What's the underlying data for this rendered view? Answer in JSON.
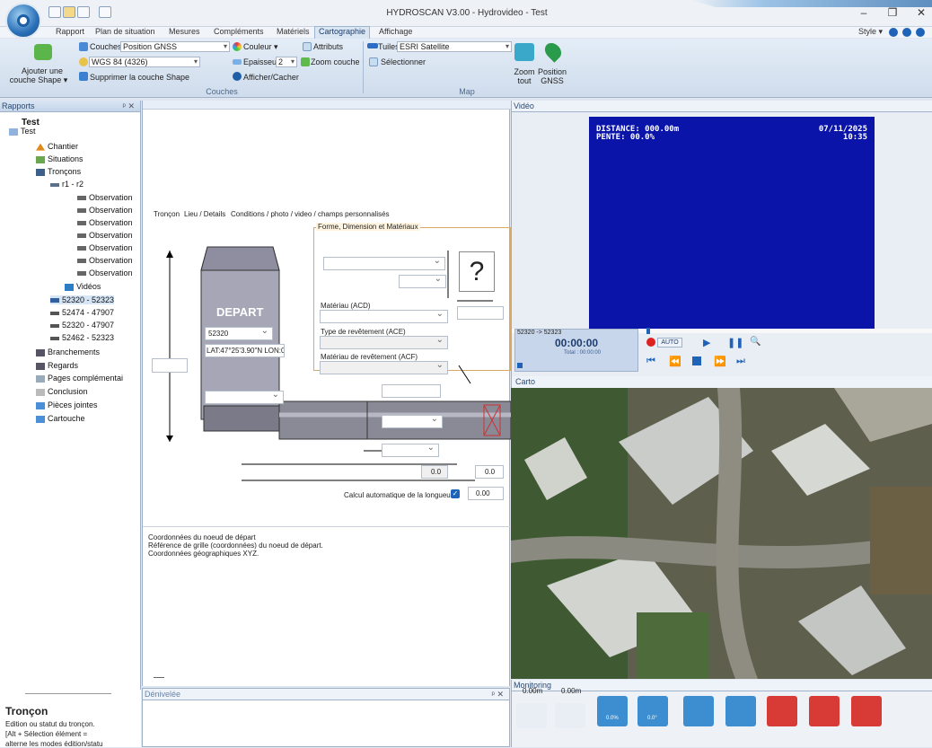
{
  "window": {
    "title": "HYDROSCAN V3.00 - Hydrovideo - Test",
    "minimize": "–",
    "restore": "❐",
    "close": "✕"
  },
  "ribbon_tabs": [
    "Rapport",
    "Plan de situation",
    "Mesures",
    "Compléments",
    "Matériels",
    "Cartographie",
    "Affichage"
  ],
  "active_tab": "Cartographie",
  "style_label": "Style",
  "ribbon": {
    "add_shape": "Ajouter une",
    "add_shape2": "couche Shape",
    "layers_label": "Couches",
    "layers_value": "Position GNSS",
    "crs_value": "WGS 84 (4326)",
    "delete_shape": "Supprimer la couche Shape",
    "color": "Couleur",
    "thickness": "Epaisseur",
    "thickness_value": "2",
    "show_hide": "Afficher/Cacher",
    "attributes": "Attributs",
    "zoom_layer": "Zoom couche",
    "tiles_label": "Tuiles",
    "tiles_value": "ESRI Satellite",
    "select": "Sélectionner",
    "zoom_all": "Zoom",
    "zoom_all2": "tout",
    "position": "Position",
    "position2": "GNSS",
    "group_layers": "Couches",
    "group_map": "Map"
  },
  "left_panel": {
    "header": "Rapports",
    "pin": "ᵖ ✕",
    "root_title": "Test",
    "root_node": "Test",
    "items": [
      "Chantier",
      "Situations",
      "Tronçons"
    ],
    "section": "r1 - r2",
    "observations": [
      "Observation",
      "Observation",
      "Observation",
      "Observation",
      "Observation",
      "Observation",
      "Observation"
    ],
    "videos": "Vidéos",
    "segments": [
      "52320 - 52323",
      "52474 - 47907",
      "52320 - 47907",
      "52462 - 52323"
    ],
    "others": [
      "Branchements",
      "Regards",
      "Pages complémentai",
      "Conclusion",
      "Pièces jointes",
      "Cartouche"
    ]
  },
  "form": {
    "tabs": [
      "Tronçon",
      "Lieu / Details",
      "Conditions / photo / video / champs personnalisés"
    ],
    "section_title": "Forme, Dimension et Matériaux",
    "depart": "DEPART",
    "node_value": "52320",
    "coords": "LAT:47°25'3.90\"N LON:0°",
    "material_label": "Matériau (ACD)",
    "coating_type_label": "Type de revêtement (ACE)",
    "coating_material_label": "Matériau de revêtement (ACF)",
    "question": "?",
    "val1": "0.0",
    "val2": "0.0",
    "val3": "0.00",
    "auto_length": "Calcul automatique de la longueur",
    "desc1": "Coordonnées du noeud de départ",
    "desc2": "Référence de grille (coordonnées) du noeud de départ.",
    "desc3": "Coordonnées géographiques XYZ."
  },
  "video": {
    "header": "Vidéo",
    "distance": "DISTANCE: 000.00m",
    "slope": "PENTE: 00.0%",
    "date": "07/11/2025",
    "time": "10:35",
    "segment": "52320 -> 52323",
    "timer": "00:00:00",
    "total": "Total : 00:00:00",
    "auto": "AUTO"
  },
  "carto": {
    "header": "Carto"
  },
  "monitoring": {
    "header": "Monitoring",
    "m1": "0.00m",
    "m2": "0.00m",
    "t1": "0.0%",
    "t2": "0.0°"
  },
  "denivelee": {
    "header": "Dénivelée"
  },
  "troncon_info": {
    "title": "Tronçon",
    "line1": "Edition ou statut du tronçon.",
    "line2": "[Alt + Sélection élément =",
    "line3": "alterne les modes édition/statu"
  }
}
